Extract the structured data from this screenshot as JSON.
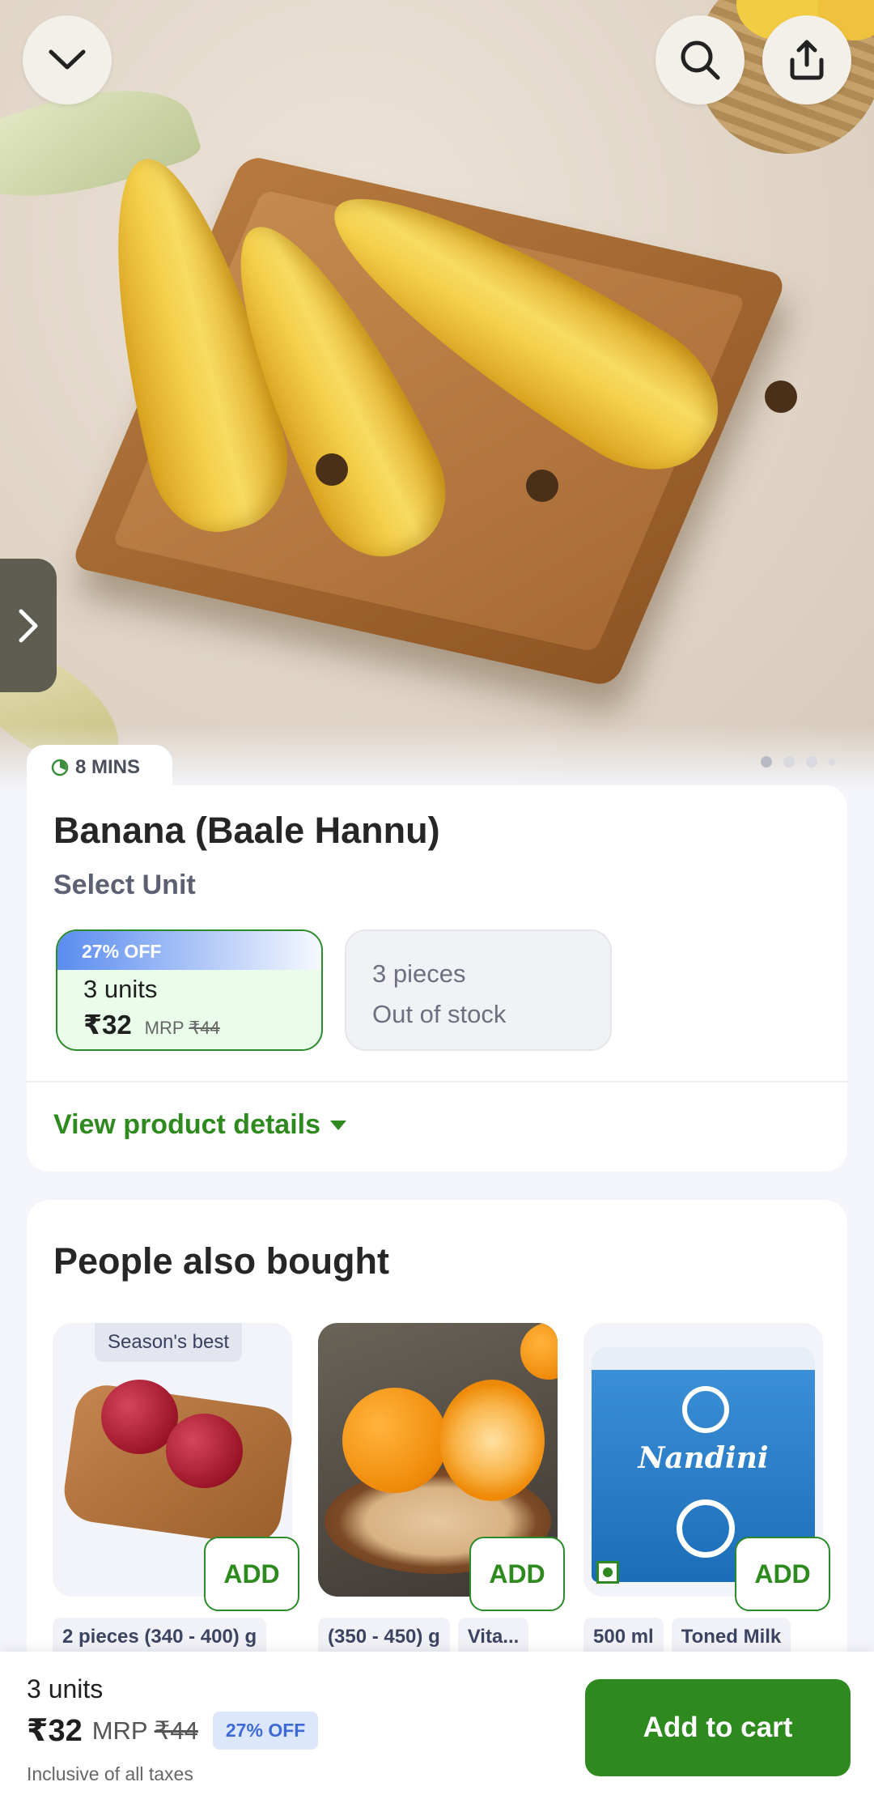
{
  "delivery": {
    "time": "8 MINS"
  },
  "product": {
    "title": "Banana (Baale Hannu)",
    "select_unit_label": "Select Unit",
    "units": [
      {
        "discount": "27% OFF",
        "name": "3 units",
        "price": "₹32",
        "mrp_label": "MRP",
        "mrp": "₹44",
        "selected": true
      },
      {
        "name": "3 pieces",
        "status": "Out of stock",
        "selected": false
      }
    ],
    "view_details": "View product details"
  },
  "people_also_bought": {
    "title": "People also bought",
    "items": [
      {
        "badge": "Season's best",
        "tags": [
          "2 pieces (340 - 400) g"
        ],
        "add_label": "ADD"
      },
      {
        "tags": [
          "(350 - 450) g",
          "Vita..."
        ],
        "add_label": "ADD"
      },
      {
        "brand_text": "Nandini",
        "tags": [
          "500 ml",
          "Toned Milk"
        ],
        "add_label": "ADD"
      }
    ]
  },
  "bottom_bar": {
    "units": "3 units",
    "price": "₹32",
    "mrp_label": "MRP",
    "mrp": "₹44",
    "discount": "27% OFF",
    "tax_note": "Inclusive of all taxes",
    "cta": "Add to cart"
  },
  "carousel": {
    "total_slides": 4,
    "active_index": 0
  },
  "colors": {
    "accent_green": "#2e8a1f",
    "discount_blue": "#3e6ad6"
  }
}
